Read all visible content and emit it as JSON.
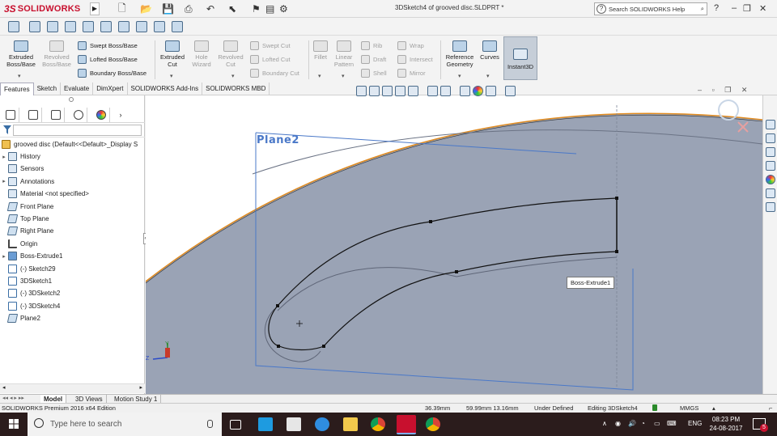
{
  "app": {
    "logo_prefix": "3S",
    "logo_name": "SOLIDWORKS",
    "window_title": "3DSketch4 of grooved disc.SLDPRT *",
    "help_search_placeholder": "Search SOLIDWORKS Help",
    "help_q": "?"
  },
  "commands": {
    "extruded_boss": "Extruded Boss/Base",
    "revolved_boss": "Revolved Boss/Base",
    "swept_boss": "Swept Boss/Base",
    "lofted_boss": "Lofted Boss/Base",
    "boundary_boss": "Boundary Boss/Base",
    "extruded_cut": "Extruded Cut",
    "hole_wizard": "Hole Wizard",
    "revolved_cut": "Revolved Cut",
    "swept_cut": "Swept Cut",
    "lofted_cut": "Lofted Cut",
    "boundary_cut": "Boundary Cut",
    "fillet": "Fillet",
    "linear_pattern": "Linear Pattern",
    "rib": "Rib",
    "draft": "Draft",
    "shell": "Shell",
    "wrap": "Wrap",
    "intersect": "Intersect",
    "mirror": "Mirror",
    "reference_geometry": "Reference Geometry",
    "curves": "Curves",
    "instant3d": "Instant3D"
  },
  "tabs": [
    "Features",
    "Sketch",
    "Evaluate",
    "DimXpert",
    "SOLIDWORKS Add-Ins",
    "SOLIDWORKS MBD"
  ],
  "tree": {
    "root": "grooved disc  (Default<<Default>_Display S",
    "items": [
      {
        "label": "History",
        "expand": "▸",
        "icon": "history-icon"
      },
      {
        "label": "Sensors",
        "expand": "",
        "icon": "sensor-icon"
      },
      {
        "label": "Annotations",
        "expand": "▸",
        "icon": "annotations-icon"
      },
      {
        "label": "Material <not specified>",
        "expand": "",
        "icon": "material-icon"
      },
      {
        "label": "Front Plane",
        "expand": "",
        "icon": "plane-icon"
      },
      {
        "label": "Top Plane",
        "expand": "",
        "icon": "plane-icon"
      },
      {
        "label": "Right Plane",
        "expand": "",
        "icon": "plane-icon"
      },
      {
        "label": "Origin",
        "expand": "",
        "icon": "origin-icon"
      },
      {
        "label": "Boss-Extrude1",
        "expand": "▸",
        "icon": "extrude-icon"
      },
      {
        "label": "(-) Sketch29",
        "expand": "",
        "icon": "sketch-icon"
      },
      {
        "label": "3DSketch1",
        "expand": "",
        "icon": "3dsketch-icon"
      },
      {
        "label": "(-) 3DSketch2",
        "expand": "",
        "icon": "3dsketch-icon"
      },
      {
        "label": "(-) 3DSketch4",
        "expand": "",
        "icon": "3dsketch-icon"
      },
      {
        "label": "Plane2",
        "expand": "",
        "icon": "plane-icon"
      }
    ]
  },
  "graphics": {
    "plane_label": "Plane2",
    "tooltip": "Boss-Extrude1",
    "triad_y": "Y",
    "triad_z": "Z"
  },
  "bottom_tabs": [
    "Model",
    "3D Views",
    "Motion Study 1"
  ],
  "status": {
    "edition": "SOLIDWORKS Premium 2016 x64 Edition",
    "coord_x": "36.39mm",
    "coord_yz": "59.99mm 13.16mm",
    "state": "Under Defined",
    "editing": "Editing 3DSketch4",
    "units": "MMGS"
  },
  "taskbar": {
    "search_placeholder": "Type here to search",
    "lang": "ENG",
    "time": "08:23 PM",
    "date": "24-08-2017",
    "notif_count": "5"
  },
  "colors": {
    "brand_red": "#c8102e",
    "plane_blue": "#4a78c8",
    "model_gray": "#9aa3b5",
    "edge_orange": "#e08a1e"
  }
}
